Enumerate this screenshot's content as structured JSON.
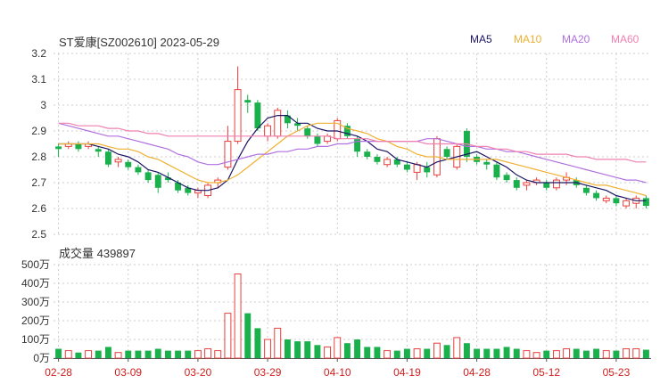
{
  "header": {
    "title": "ST爱康[SZ002610] 2023-05-29"
  },
  "legend": [
    {
      "label": "MA5",
      "color": "#1b1464"
    },
    {
      "label": "MA10",
      "color": "#f0b030"
    },
    {
      "label": "MA20",
      "color": "#b070e0"
    },
    {
      "label": "MA60",
      "color": "#f080b0"
    }
  ],
  "volume_title": "成交量 439897",
  "colors": {
    "up": "#e8403c",
    "down": "#1ab04c",
    "grid": "#cccccc"
  },
  "chart_data": [
    {
      "type": "candlestick",
      "title": "ST爱康[SZ002610] 2023-05-29",
      "ylim": [
        2.5,
        3.2
      ],
      "yticks": [
        "3.2",
        "3.1",
        "3",
        "2.9",
        "2.8",
        "2.7",
        "2.6",
        "2.5"
      ],
      "x_tick_labels": [
        "02-28",
        "03-09",
        "03-20",
        "03-29",
        "04-10",
        "04-19",
        "04-28",
        "05-12",
        "05-23"
      ],
      "x_tick_index": [
        0,
        7,
        14,
        21,
        28,
        35,
        42,
        49,
        56
      ],
      "series_names": [
        "MA5",
        "MA10",
        "MA20",
        "MA60"
      ],
      "ohlc": [
        [
          2.84,
          2.85,
          2.8,
          2.83
        ],
        [
          2.84,
          2.86,
          2.83,
          2.85
        ],
        [
          2.85,
          2.86,
          2.82,
          2.83
        ],
        [
          2.84,
          2.86,
          2.83,
          2.85
        ],
        [
          2.83,
          2.84,
          2.8,
          2.82
        ],
        [
          2.82,
          2.83,
          2.76,
          2.77
        ],
        [
          2.78,
          2.8,
          2.76,
          2.79
        ],
        [
          2.78,
          2.79,
          2.75,
          2.76
        ],
        [
          2.76,
          2.77,
          2.73,
          2.74
        ],
        [
          2.74,
          2.75,
          2.7,
          2.71
        ],
        [
          2.73,
          2.74,
          2.66,
          2.68
        ],
        [
          2.72,
          2.74,
          2.7,
          2.71
        ],
        [
          2.7,
          2.71,
          2.66,
          2.67
        ],
        [
          2.68,
          2.69,
          2.65,
          2.66
        ],
        [
          2.66,
          2.68,
          2.64,
          2.67
        ],
        [
          2.65,
          2.7,
          2.64,
          2.69
        ],
        [
          2.7,
          2.72,
          2.68,
          2.71
        ],
        [
          2.76,
          2.92,
          2.75,
          2.86
        ],
        [
          2.86,
          3.15,
          2.85,
          3.06
        ],
        [
          3.02,
          3.04,
          2.97,
          3.01
        ],
        [
          3.01,
          3.02,
          2.9,
          2.91
        ],
        [
          2.88,
          2.93,
          2.86,
          2.92
        ],
        [
          2.88,
          2.99,
          2.87,
          2.98
        ],
        [
          2.96,
          2.98,
          2.91,
          2.93
        ],
        [
          2.93,
          2.95,
          2.9,
          2.92
        ],
        [
          2.91,
          2.92,
          2.87,
          2.88
        ],
        [
          2.88,
          2.89,
          2.84,
          2.85
        ],
        [
          2.86,
          2.89,
          2.85,
          2.88
        ],
        [
          2.87,
          2.95,
          2.86,
          2.94
        ],
        [
          2.92,
          2.93,
          2.87,
          2.88
        ],
        [
          2.87,
          2.88,
          2.8,
          2.82
        ],
        [
          2.82,
          2.83,
          2.79,
          2.8
        ],
        [
          2.8,
          2.81,
          2.77,
          2.78
        ],
        [
          2.77,
          2.8,
          2.76,
          2.79
        ],
        [
          2.79,
          2.8,
          2.76,
          2.77
        ],
        [
          2.77,
          2.78,
          2.74,
          2.75
        ],
        [
          2.74,
          2.78,
          2.71,
          2.77
        ],
        [
          2.76,
          2.78,
          2.72,
          2.74
        ],
        [
          2.73,
          2.88,
          2.72,
          2.87
        ],
        [
          2.83,
          2.84,
          2.79,
          2.8
        ],
        [
          2.76,
          2.85,
          2.75,
          2.84
        ],
        [
          2.9,
          2.91,
          2.78,
          2.8
        ],
        [
          2.8,
          2.81,
          2.77,
          2.78
        ],
        [
          2.78,
          2.79,
          2.75,
          2.77
        ],
        [
          2.77,
          2.78,
          2.71,
          2.72
        ],
        [
          2.73,
          2.74,
          2.7,
          2.71
        ],
        [
          2.71,
          2.72,
          2.67,
          2.68
        ],
        [
          2.69,
          2.71,
          2.67,
          2.7
        ],
        [
          2.7,
          2.72,
          2.69,
          2.71
        ],
        [
          2.7,
          2.71,
          2.67,
          2.68
        ],
        [
          2.68,
          2.72,
          2.67,
          2.71
        ],
        [
          2.71,
          2.74,
          2.69,
          2.72
        ],
        [
          2.71,
          2.72,
          2.68,
          2.69
        ],
        [
          2.68,
          2.69,
          2.65,
          2.66
        ],
        [
          2.66,
          2.67,
          2.63,
          2.64
        ],
        [
          2.63,
          2.65,
          2.62,
          2.64
        ],
        [
          2.64,
          2.65,
          2.61,
          2.62
        ],
        [
          2.61,
          2.64,
          2.6,
          2.63
        ],
        [
          2.62,
          2.65,
          2.6,
          2.64
        ],
        [
          2.64,
          2.65,
          2.6,
          2.61
        ]
      ],
      "ma5": [
        2.85,
        2.85,
        2.85,
        2.85,
        2.84,
        2.83,
        2.81,
        2.8,
        2.78,
        2.75,
        2.74,
        2.72,
        2.7,
        2.68,
        2.67,
        2.67,
        2.68,
        2.71,
        2.79,
        2.86,
        2.91,
        2.95,
        2.96,
        2.96,
        2.93,
        2.93,
        2.91,
        2.9,
        2.9,
        2.89,
        2.88,
        2.86,
        2.83,
        2.82,
        2.79,
        2.78,
        2.77,
        2.76,
        2.78,
        2.79,
        2.8,
        2.81,
        2.82,
        2.8,
        2.78,
        2.76,
        2.73,
        2.71,
        2.7,
        2.7,
        2.7,
        2.7,
        2.7,
        2.69,
        2.68,
        2.67,
        2.65,
        2.64,
        2.63,
        2.63
      ],
      "ma10": [
        2.85,
        2.85,
        2.85,
        2.85,
        2.85,
        2.84,
        2.83,
        2.83,
        2.82,
        2.8,
        2.79,
        2.77,
        2.75,
        2.73,
        2.71,
        2.7,
        2.7,
        2.71,
        2.73,
        2.76,
        2.79,
        2.82,
        2.85,
        2.88,
        2.9,
        2.92,
        2.93,
        2.93,
        2.93,
        2.91,
        2.9,
        2.89,
        2.87,
        2.86,
        2.84,
        2.83,
        2.81,
        2.8,
        2.8,
        2.79,
        2.79,
        2.79,
        2.79,
        2.79,
        2.79,
        2.78,
        2.77,
        2.76,
        2.75,
        2.74,
        2.73,
        2.72,
        2.71,
        2.7,
        2.69,
        2.69,
        2.68,
        2.67,
        2.66,
        2.65
      ],
      "ma20": [
        2.93,
        2.92,
        2.91,
        2.9,
        2.89,
        2.88,
        2.88,
        2.87,
        2.86,
        2.85,
        2.84,
        2.83,
        2.81,
        2.8,
        2.78,
        2.77,
        2.77,
        2.78,
        2.79,
        2.8,
        2.81,
        2.81,
        2.82,
        2.82,
        2.83,
        2.83,
        2.84,
        2.84,
        2.85,
        2.85,
        2.86,
        2.86,
        2.86,
        2.86,
        2.86,
        2.86,
        2.86,
        2.87,
        2.87,
        2.86,
        2.85,
        2.84,
        2.84,
        2.83,
        2.83,
        2.82,
        2.82,
        2.81,
        2.8,
        2.79,
        2.78,
        2.77,
        2.76,
        2.75,
        2.74,
        2.73,
        2.72,
        2.71,
        2.71,
        2.7
      ],
      "ma60": [
        2.93,
        2.93,
        2.92,
        2.92,
        2.92,
        2.91,
        2.91,
        2.9,
        2.9,
        2.89,
        2.89,
        2.88,
        2.88,
        2.88,
        2.88,
        2.88,
        2.88,
        2.88,
        2.88,
        2.88,
        2.88,
        2.88,
        2.88,
        2.88,
        2.88,
        2.88,
        2.88,
        2.88,
        2.87,
        2.87,
        2.87,
        2.87,
        2.86,
        2.86,
        2.86,
        2.86,
        2.86,
        2.85,
        2.85,
        2.85,
        2.85,
        2.85,
        2.84,
        2.84,
        2.83,
        2.83,
        2.82,
        2.82,
        2.81,
        2.81,
        2.81,
        2.81,
        2.8,
        2.8,
        2.79,
        2.79,
        2.79,
        2.79,
        2.78,
        2.78
      ]
    },
    {
      "type": "bar",
      "title": "成交量 439897",
      "ylabel_unit": "万",
      "ylim": [
        0,
        500
      ],
      "yticks": [
        "500万",
        "400万",
        "300万",
        "200万",
        "100万",
        "0万"
      ],
      "values": [
        50,
        40,
        30,
        40,
        40,
        60,
        30,
        40,
        40,
        40,
        50,
        40,
        40,
        40,
        40,
        50,
        40,
        240,
        450,
        240,
        160,
        100,
        160,
        100,
        90,
        90,
        70,
        60,
        110,
        80,
        100,
        60,
        60,
        40,
        40,
        50,
        50,
        50,
        80,
        70,
        110,
        80,
        50,
        50,
        50,
        60,
        50,
        40,
        30,
        40,
        40,
        50,
        50,
        40,
        50,
        40,
        40,
        50,
        50,
        45
      ]
    }
  ]
}
